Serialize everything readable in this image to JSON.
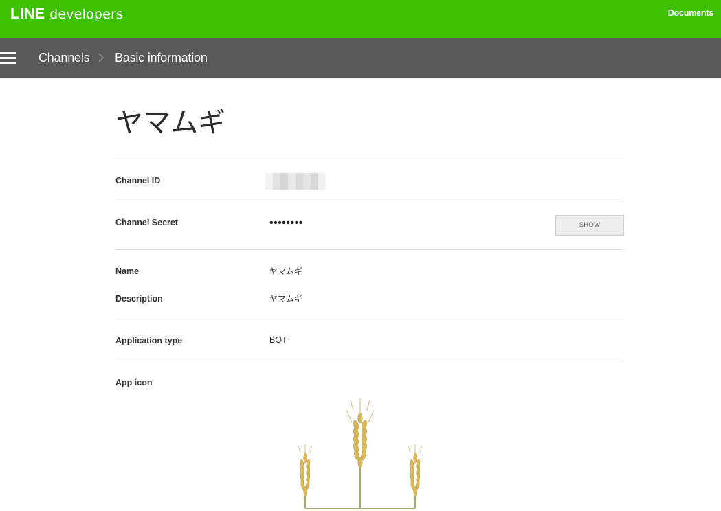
{
  "header": {
    "logo_line": "LINE",
    "logo_developers": "developers",
    "documents_link": "Documents",
    "background_color": "#3ec000"
  },
  "navbar": {
    "menu_icon": "hamburger-menu-icon",
    "breadcrumb": [
      "Channels",
      "Basic information"
    ],
    "separator_icon": "chevron-right-icon",
    "background_color": "#585858"
  },
  "channel": {
    "title": "ヤマムギ",
    "fields": {
      "channel_id": {
        "label": "Channel ID",
        "value": ""
      },
      "channel_secret": {
        "label": "Channel Secret",
        "value": "••••••••",
        "show_button": "SHOW"
      },
      "name": {
        "label": "Name",
        "value": "ヤマムギ"
      },
      "description": {
        "label": "Description",
        "value": "ヤマムギ"
      },
      "application_type": {
        "label": "Application type",
        "value": "BOT"
      },
      "app_icon": {
        "label": "App icon",
        "icon": "wheat-icon"
      }
    }
  }
}
